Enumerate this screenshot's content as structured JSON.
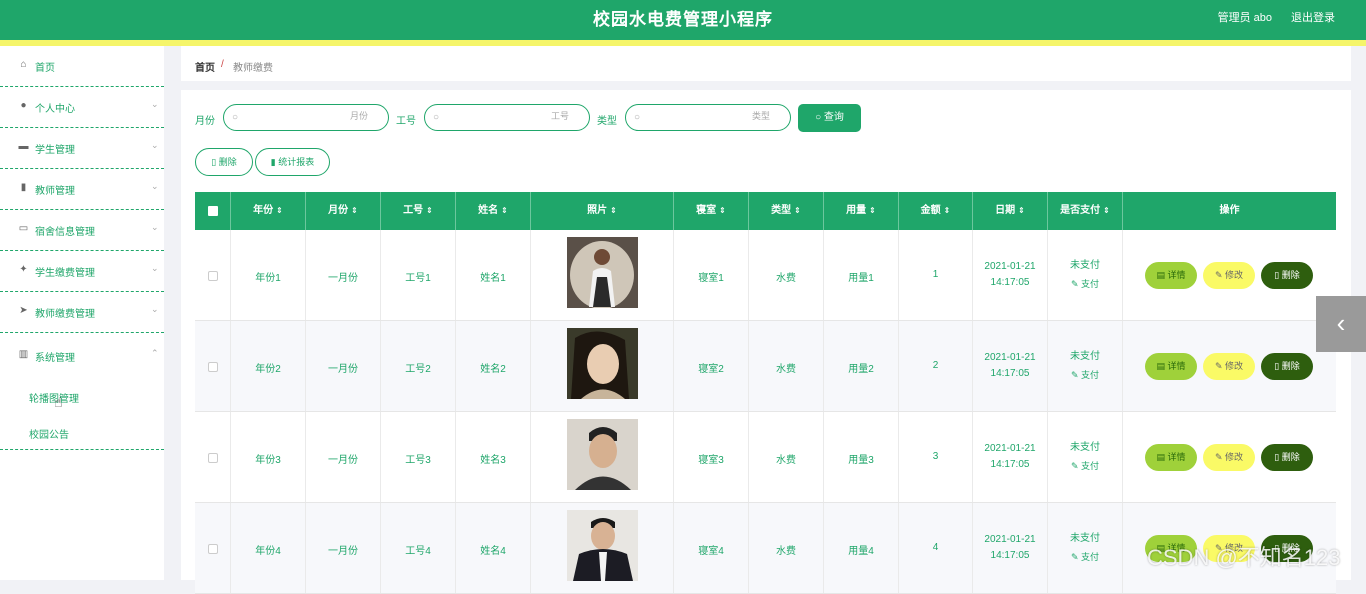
{
  "header": {
    "title": "校园水电费管理小程序",
    "user": "管理员 abo",
    "logout": "退出登录"
  },
  "sidebar": {
    "items": [
      {
        "label": "首页",
        "icon": "home-icon"
      },
      {
        "label": "个人中心",
        "icon": "user-icon"
      },
      {
        "label": "学生管理",
        "icon": "monitor-icon"
      },
      {
        "label": "教师管理",
        "icon": "clipboard-icon"
      },
      {
        "label": "宿舍信息管理",
        "icon": "chat-icon"
      },
      {
        "label": "学生缴费管理",
        "icon": "thumb-icon"
      },
      {
        "label": "教师缴费管理",
        "icon": "send-icon"
      },
      {
        "label": "系统管理",
        "icon": "books-icon"
      }
    ],
    "sub_items": [
      "轮播图管理",
      "校园公告"
    ]
  },
  "breadcrumb": {
    "home": "首页",
    "separator": "/",
    "current": "教师缴费"
  },
  "filters": {
    "month_label": "月份",
    "month_placeholder": "月份",
    "id_label": "工号",
    "id_placeholder": "工号",
    "type_label": "类型",
    "type_placeholder": "类型",
    "query_button": "查询"
  },
  "actions": {
    "delete": "删除",
    "report": "统计报表"
  },
  "table": {
    "columns": [
      "年份",
      "月份",
      "工号",
      "姓名",
      "照片",
      "寝室",
      "类型",
      "用量",
      "金额",
      "日期",
      "是否支付",
      "操作"
    ],
    "rows": [
      {
        "year": "年份1",
        "month": "一月份",
        "id": "工号1",
        "name": "姓名1",
        "room": "寝室1",
        "type": "水费",
        "usage": "用量1",
        "amount": "1",
        "date": "2021-01-21",
        "time": "14:17:05",
        "paid": "未支付",
        "pay": "支付"
      },
      {
        "year": "年份2",
        "month": "一月份",
        "id": "工号2",
        "name": "姓名2",
        "room": "寝室2",
        "type": "水费",
        "usage": "用量2",
        "amount": "2",
        "date": "2021-01-21",
        "time": "14:17:05",
        "paid": "未支付",
        "pay": "支付"
      },
      {
        "year": "年份3",
        "month": "一月份",
        "id": "工号3",
        "name": "姓名3",
        "room": "寝室3",
        "type": "水费",
        "usage": "用量3",
        "amount": "3",
        "date": "2021-01-21",
        "time": "14:17:05",
        "paid": "未支付",
        "pay": "支付"
      },
      {
        "year": "年份4",
        "month": "一月份",
        "id": "工号4",
        "name": "姓名4",
        "room": "寝室4",
        "type": "水费",
        "usage": "用量4",
        "amount": "4",
        "date": "2021-01-21",
        "time": "14:17:05",
        "paid": "未支付",
        "pay": "支付"
      }
    ],
    "row_actions": {
      "detail": "详情",
      "edit": "修改",
      "delete": "删除"
    }
  },
  "watermark": "CSDN @不知名123",
  "colors": {
    "primary": "#1fa66a",
    "accent_yellow": "#f5f56a",
    "detail_btn": "#9fd13a",
    "edit_btn": "#fafa66",
    "delete_btn": "#2e5e0e"
  }
}
